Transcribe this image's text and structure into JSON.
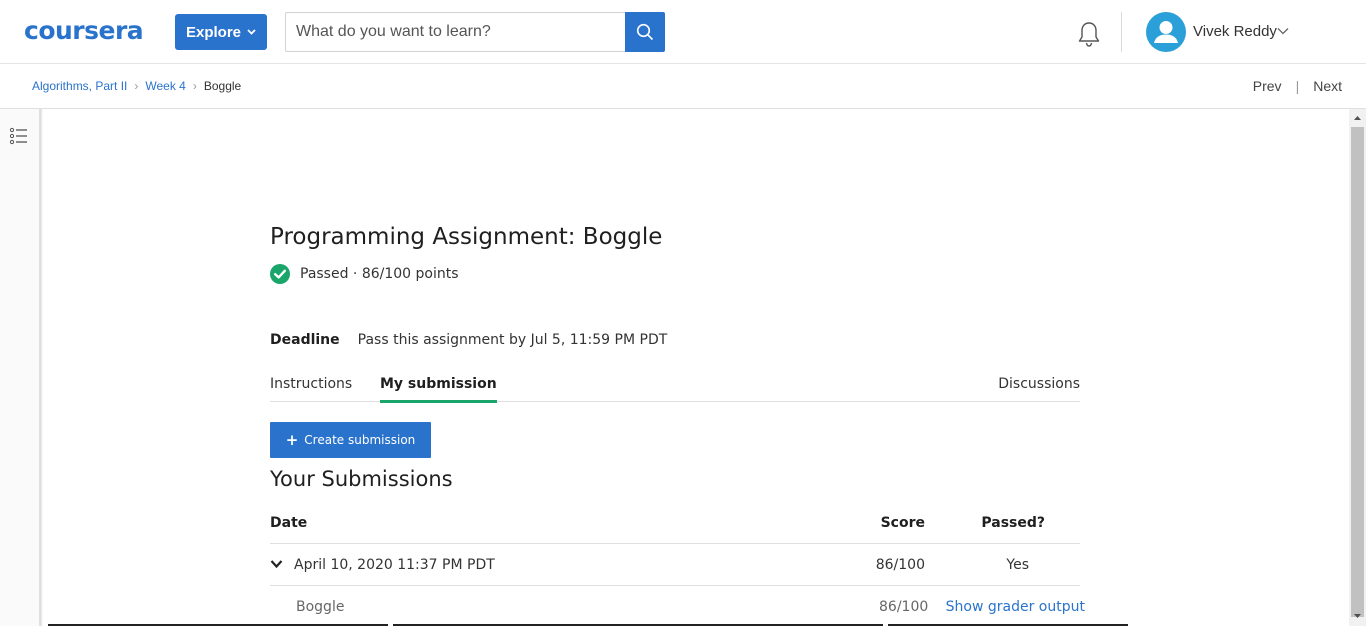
{
  "header": {
    "logo": "coursera",
    "explore_label": "Explore",
    "search_placeholder": "What do you want to learn?",
    "user_name": "Vivek Reddy"
  },
  "breadcrumb": {
    "items": [
      "Algorithms, Part II",
      "Week 4"
    ],
    "current": "Boggle",
    "prev": "Prev",
    "next": "Next"
  },
  "assignment": {
    "title": "Programming Assignment: Boggle",
    "status": "Passed · 86/100 points",
    "deadline_label": "Deadline",
    "deadline_text": "Pass this assignment by Jul 5, 11:59 PM PDT"
  },
  "tabs": {
    "instructions": "Instructions",
    "my_submission": "My submission",
    "discussions": "Discussions"
  },
  "create_button": "Create submission",
  "submissions": {
    "title": "Your Submissions",
    "columns": {
      "date": "Date",
      "score": "Score",
      "passed": "Passed?"
    },
    "rows": [
      {
        "date": "April 10, 2020 11:37 PM PDT",
        "score": "86/100",
        "passed": "Yes",
        "part_name": "Boggle",
        "part_score": "86/100",
        "grader_link": "Show grader output"
      }
    ]
  },
  "colors": {
    "brand_blue": "#2a73cc",
    "success_green": "#1aa56b",
    "avatar_blue": "#2a9fd8"
  },
  "icons": [
    "search-icon",
    "bell-icon",
    "user-avatar-icon",
    "chevron-down-icon",
    "list-icon",
    "check-circle-icon",
    "plus-icon"
  ]
}
